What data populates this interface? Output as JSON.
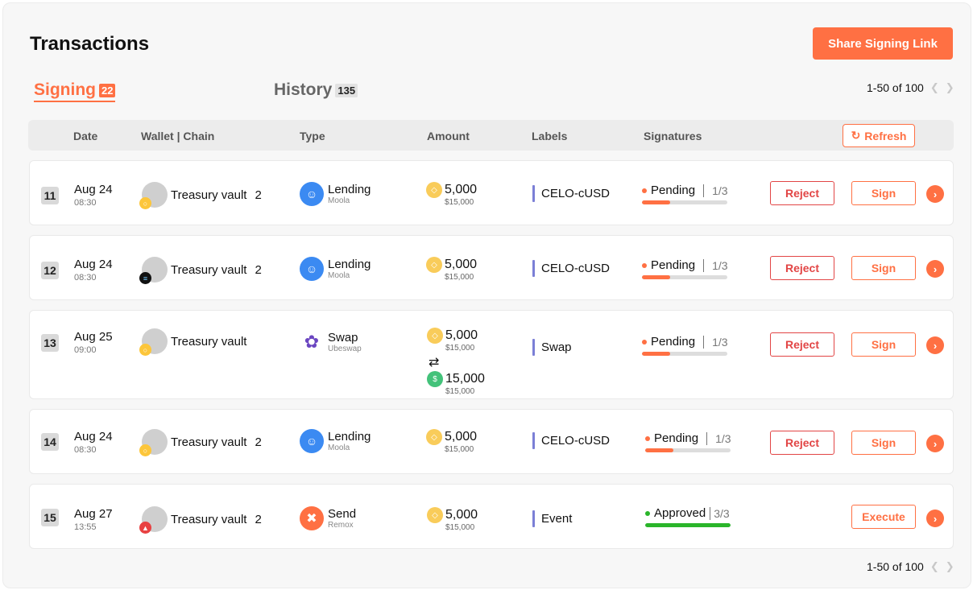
{
  "header": {
    "title": "Transactions",
    "share_label": "Share Signing Link"
  },
  "tabs": [
    {
      "label": "Signing",
      "count": "22",
      "active": true
    },
    {
      "label": "History",
      "count": "135",
      "active": false
    }
  ],
  "pagination": {
    "text": "1-50 of 100",
    "prev_icon": "chevron-left-icon",
    "next_icon": "chevron-right-icon"
  },
  "table": {
    "columns": [
      "Date",
      "Wallet | Chain",
      "Type",
      "Amount",
      "Labels",
      "Signatures"
    ],
    "refresh_label": "Refresh"
  },
  "colors": {
    "accent": "#ff7043",
    "reject": "#e24545",
    "approved": "#2ab52a",
    "label_bar": "#7b7fd6"
  },
  "rows": [
    {
      "num": "11",
      "date": "Aug 24",
      "time": "08:30",
      "wallet": "Treasury vault",
      "wallet_count": "2",
      "chain_icon": "celo-icon",
      "type": "Lending",
      "protocol": "Moola",
      "protocol_icon": "moola-icon",
      "amounts": [
        {
          "value": "5,000",
          "usd": "$15,000",
          "coin_icon": "celo-coin-icon"
        }
      ],
      "label": "CELO-cUSD",
      "status": "Pending",
      "signatures": "1/3",
      "progress": 0.33,
      "reject_label": "Reject",
      "action_label": "Sign"
    },
    {
      "num": "12",
      "date": "Aug 24",
      "time": "08:30",
      "wallet": "Treasury vault",
      "wallet_count": "2",
      "chain_icon": "solana-icon",
      "type": "Lending",
      "protocol": "Moola",
      "protocol_icon": "moola-icon",
      "amounts": [
        {
          "value": "5,000",
          "usd": "$15,000",
          "coin_icon": "celo-coin-icon"
        }
      ],
      "label": "CELO-cUSD",
      "status": "Pending",
      "signatures": "1/3",
      "progress": 0.33,
      "reject_label": "Reject",
      "action_label": "Sign"
    },
    {
      "num": "13",
      "date": "Aug 25",
      "time": "09:00",
      "wallet": "Treasury vault",
      "wallet_count": "",
      "chain_icon": "celo-icon",
      "type": "Swap",
      "protocol": "Ubeswap",
      "protocol_icon": "ubeswap-icon",
      "amounts": [
        {
          "value": "5,000",
          "usd": "$15,000",
          "coin_icon": "celo-coin-icon"
        },
        {
          "value": "15,000",
          "usd": "$15,000",
          "coin_icon": "cusd-coin-icon"
        }
      ],
      "label": "Swap",
      "status": "Pending",
      "signatures": "1/3",
      "progress": 0.33,
      "reject_label": "Reject",
      "action_label": "Sign"
    },
    {
      "num": "14",
      "date": "Aug 24",
      "time": "08:30",
      "wallet": "Treasury vault",
      "wallet_count": "2",
      "chain_icon": "celo-icon",
      "type": "Lending",
      "protocol": "Moola",
      "protocol_icon": "moola-icon",
      "amounts": [
        {
          "value": "5,000",
          "usd": "$15,000",
          "coin_icon": "celo-coin-icon"
        }
      ],
      "label": "CELO-cUSD",
      "status": "Pending",
      "signatures": "1/3",
      "progress": 0.33,
      "reject_label": "Reject",
      "action_label": "Sign"
    },
    {
      "num": "15",
      "date": "Aug 27",
      "time": "13:55",
      "wallet": "Treasury vault",
      "wallet_count": "2",
      "chain_icon": "avalanche-icon",
      "type": "Send",
      "protocol": "Remox",
      "protocol_icon": "remox-icon",
      "amounts": [
        {
          "value": "5,000",
          "usd": "$15,000",
          "coin_icon": "celo-coin-icon"
        }
      ],
      "label": "Event",
      "status": "Approved",
      "signatures": "3/3",
      "progress": 1.0,
      "reject_label": "",
      "action_label": "Execute"
    }
  ]
}
